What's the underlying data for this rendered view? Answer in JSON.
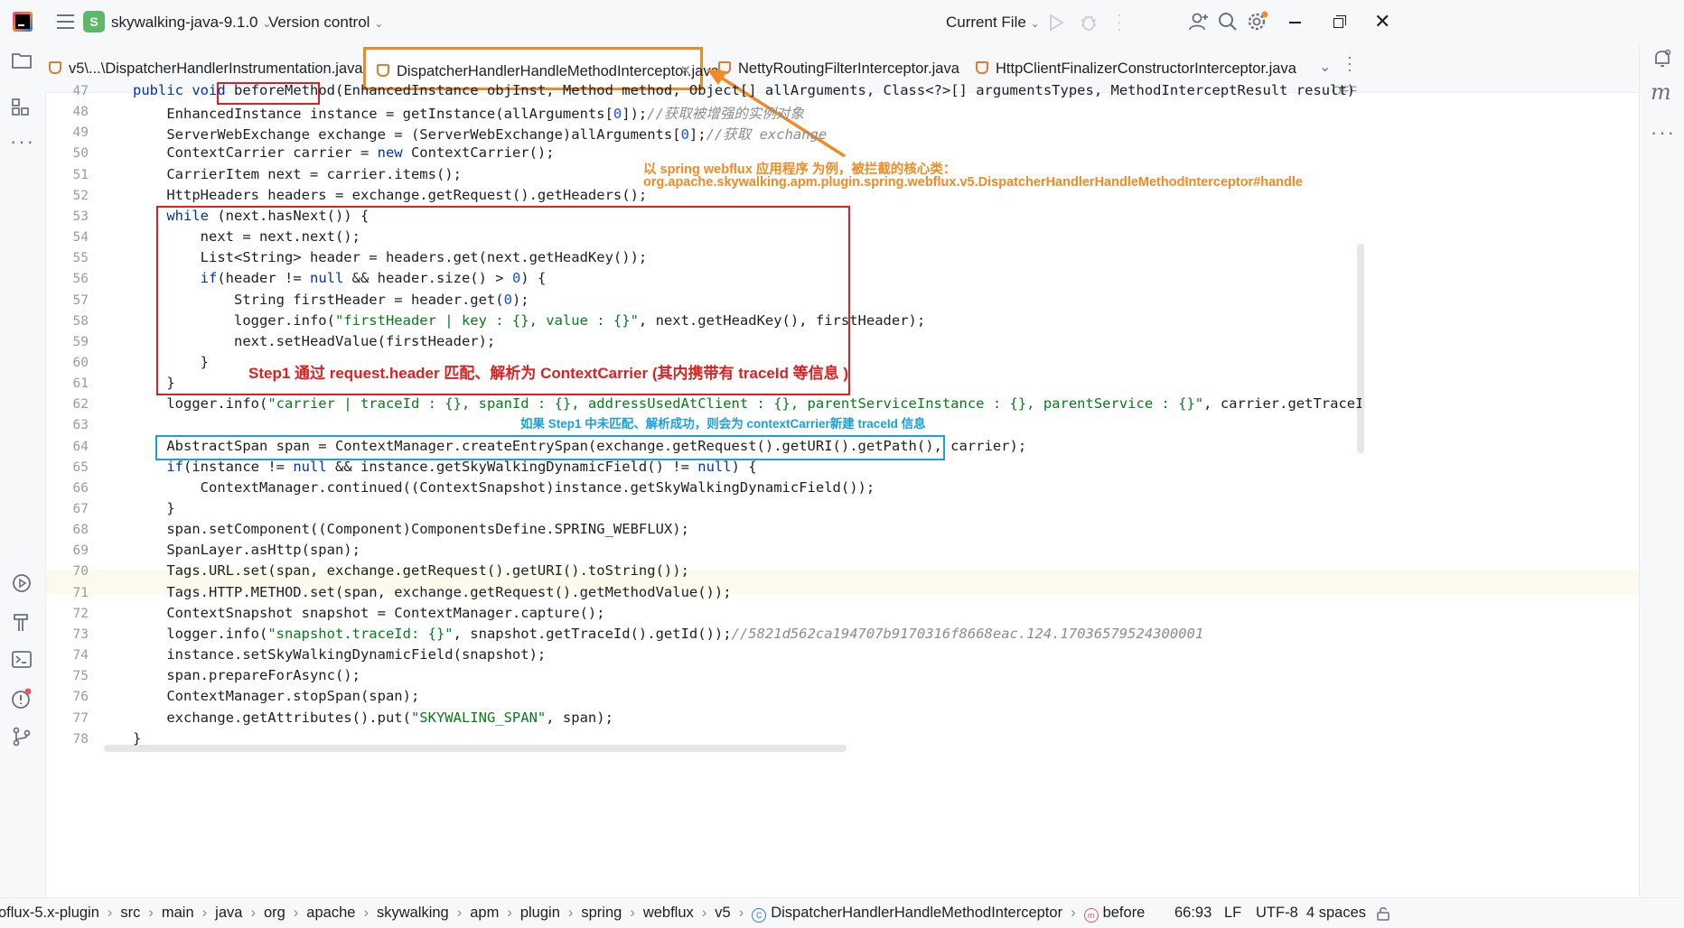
{
  "titlebar": {
    "project_badge": "S",
    "project_name": "skywalking-java-9.1.0",
    "vcs_menu": "Version control",
    "run_config": "Current File"
  },
  "tabs": [
    {
      "label": "v5\\...\\DispatcherHandlerInstrumentation.java",
      "active": false
    },
    {
      "label": "DispatcherHandlerHandleMethodInterceptor.java",
      "active": true
    },
    {
      "label": "NettyRoutingFilterInterceptor.java",
      "active": false
    },
    {
      "label": "HttpClientFinalizerConstructorInterceptor.java",
      "active": false
    }
  ],
  "editor": {
    "inlay_off": "OFF",
    "lines": [
      {
        "n": "47",
        "html": "public void beforeMethod(EnhancedInstance objInst, Method method, Object[] allArguments, Class<?>[] argumentsTypes, MethodInterceptResult result) throws Throw"
      },
      {
        "n": "48",
        "html": "    EnhancedInstance instance = getInstance(allArguments[0]);//获取被增强的实例对象"
      },
      {
        "n": "49",
        "html": "    ServerWebExchange exchange = (ServerWebExchange)allArguments[0];//获取 exchange"
      },
      {
        "n": "50",
        "html": "    ContextCarrier carrier = new ContextCarrier();"
      },
      {
        "n": "51",
        "html": "    CarrierItem next = carrier.items();"
      },
      {
        "n": "52",
        "html": "    HttpHeaders headers = exchange.getRequest().getHeaders();"
      },
      {
        "n": "53",
        "html": "    while (next.hasNext()) {"
      },
      {
        "n": "54",
        "html": "        next = next.next();"
      },
      {
        "n": "55",
        "html": "        List<String> header = headers.get(next.getHeadKey());"
      },
      {
        "n": "56",
        "html": "        if(header != null && header.size() > 0) {"
      },
      {
        "n": "57",
        "html": "            String firstHeader = header.get(0);"
      },
      {
        "n": "58",
        "html": "            logger.info(\"firstHeader | key : {}, value : {}\", next.getHeadKey(), firstHeader);"
      },
      {
        "n": "59",
        "html": "            next.setHeadValue(firstHeader);"
      },
      {
        "n": "60",
        "html": "        }"
      },
      {
        "n": "61",
        "html": "    }"
      },
      {
        "n": "62",
        "html": "    logger.info(\"carrier | traceId : {}, spanId : {}, addressUsedAtClient : {}, parentServiceInstance : {}, parentService : {}\", carrier.getTraceId(), carrier.getS"
      },
      {
        "n": "63",
        "html": ""
      },
      {
        "n": "64",
        "html": "    AbstractSpan span = ContextManager.createEntrySpan(exchange.getRequest().getURI().getPath(), carrier);"
      },
      {
        "n": "65",
        "html": "    if(instance != null && instance.getSkyWalkingDynamicField() != null) {"
      },
      {
        "n": "66",
        "html": "        ContextManager.continued((ContextSnapshot)instance.getSkyWalkingDynamicField());"
      },
      {
        "n": "67",
        "html": "    }"
      },
      {
        "n": "68",
        "html": "    span.setComponent((Component)ComponentsDefine.SPRING_WEBFLUX);"
      },
      {
        "n": "69",
        "html": "    SpanLayer.asHttp(span);"
      },
      {
        "n": "70",
        "html": "    Tags.URL.set(span, exchange.getRequest().getURI().toString());"
      },
      {
        "n": "71",
        "html": "    Tags.HTTP.METHOD.set(span, exchange.getRequest().getMethodValue());"
      },
      {
        "n": "72",
        "html": "    ContextSnapshot snapshot = ContextManager.capture();"
      },
      {
        "n": "73",
        "html": "    logger.info(\"snapshot.traceId: {}\", snapshot.getTraceId().getId());//5821d562ca194707b9170316f8668eac.124.17036579524300001"
      },
      {
        "n": "74",
        "html": "    instance.setSkyWalkingDynamicField(snapshot);"
      },
      {
        "n": "75",
        "html": "    span.prepareForAsync();"
      },
      {
        "n": "76",
        "html": "    ContextManager.stopSpan(span);"
      },
      {
        "n": "77",
        "html": "    exchange.getAttributes().put(\"SKYWALING_SPAN\", span);"
      },
      {
        "n": "78",
        "html": "}"
      }
    ]
  },
  "annotations": {
    "orange_line1": "以 spring webflux 应用程序 为例，被拦截的核心类：",
    "orange_line2": "org.apache.skywalking.apm.plugin.spring.webflux.v5.DispatcherHandlerHandleMethodInterceptor#handle",
    "red_step1": "Step1 通过 request.header 匹配、解析为 ContextCarrier (其内携带有 traceId 等信息 )",
    "blue_note": "如果 Step1 中未匹配、解析成功，则会为 contextCarrier新建 traceId 信息"
  },
  "statusbar": {
    "breadcrumbs": [
      "oflux-5.x-plugin",
      "src",
      "main",
      "java",
      "org",
      "apache",
      "skywalking",
      "apm",
      "plugin",
      "spring",
      "webflux",
      "v5",
      "DispatcherHandlerHandleMethodInterceptor",
      "beforeMethod"
    ],
    "position": "66:93",
    "line_sep": "LF",
    "encoding": "UTF-8",
    "indent": "4 spaces"
  },
  "colors": {
    "orange": "#f08a24",
    "red": "#e02020",
    "blue": "#1a9fe0"
  }
}
